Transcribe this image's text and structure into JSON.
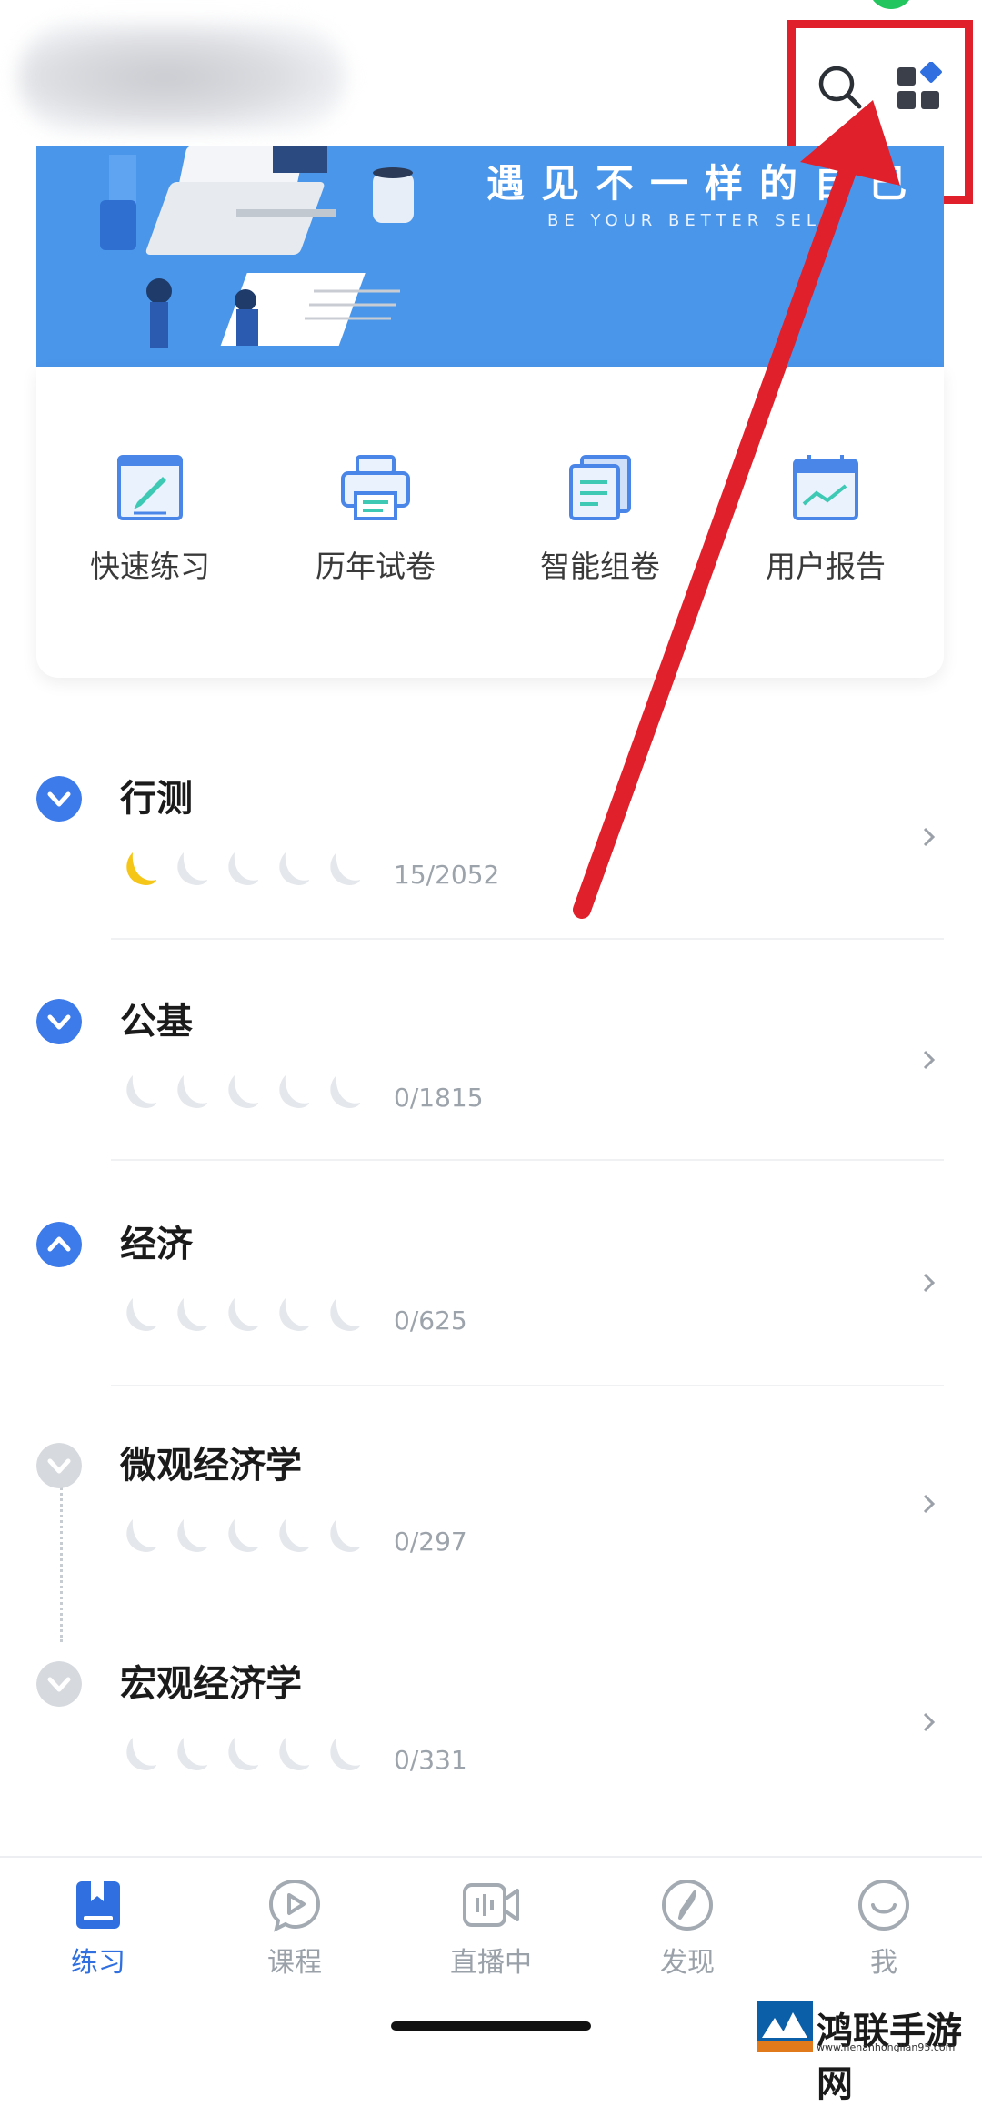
{
  "banner": {
    "title": "遇见不一样的自己",
    "subtitle": "BE YOUR BETTER SELF"
  },
  "quick_actions": [
    {
      "label": "快速练习",
      "icon": "pencil-paper-icon"
    },
    {
      "label": "历年试卷",
      "icon": "printer-icon"
    },
    {
      "label": "智能组卷",
      "icon": "stacked-papers-icon"
    },
    {
      "label": "用户报告",
      "icon": "calendar-chart-icon"
    }
  ],
  "subjects": [
    {
      "title": "行测",
      "count": "15/2052",
      "state": "collapsed-blue",
      "moons_filled": 1
    },
    {
      "title": "公基",
      "count": "0/1815",
      "state": "collapsed-blue",
      "moons_filled": 0
    },
    {
      "title": "经济",
      "count": "0/625",
      "state": "expanded-blue",
      "moons_filled": 0
    },
    {
      "title": "微观经济学",
      "count": "0/297",
      "state": "child-gray",
      "moons_filled": 0
    },
    {
      "title": "宏观经济学",
      "count": "0/331",
      "state": "child-gray",
      "moons_filled": 0
    }
  ],
  "tabs": [
    {
      "label": "练习",
      "icon": "book-icon",
      "active": true
    },
    {
      "label": "课程",
      "icon": "play-bubble-icon",
      "active": false
    },
    {
      "label": "直播中",
      "icon": "live-camera-icon",
      "active": false
    },
    {
      "label": "发现",
      "icon": "compass-icon",
      "active": false
    },
    {
      "label": "我",
      "icon": "smile-icon",
      "active": false
    }
  ],
  "watermark": {
    "name": "鸿联手游网",
    "url": "www.henanhonglian95.com"
  },
  "colors": {
    "accent": "#2f6fe0",
    "banner": "#4a96ea",
    "highlight": "#e0202a",
    "moon_filled": "#f5c518",
    "moon_empty": "#e4e7eb"
  }
}
